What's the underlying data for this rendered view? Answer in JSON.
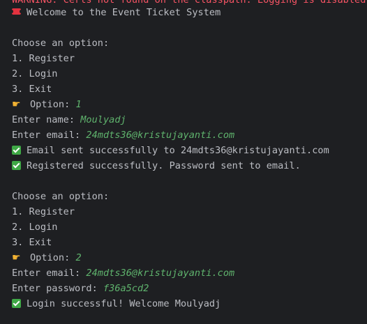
{
  "console": {
    "warning": "WARNING: Certs not found on the classpath. Logging is disabled.",
    "welcome": "Welcome to the Event Ticket System",
    "menu1": {
      "header": "Choose an option:",
      "opt1": "1. Register",
      "opt2": "2. Login",
      "opt3": "3. Exit",
      "option_prompt": "Option: ",
      "option_value": "1"
    },
    "register": {
      "name_prompt": "Enter name: ",
      "name_value": "Moulyadj",
      "email_prompt": "Enter email: ",
      "email_value": "24mdts36@kristujayanti.com",
      "msg_email_sent": "Email sent successfully to 24mdts36@kristujayanti.com",
      "msg_registered": "Registered successfully. Password sent to email."
    },
    "menu2": {
      "header": "Choose an option:",
      "opt1": "1. Register",
      "opt2": "2. Login",
      "opt3": "3. Exit",
      "option_prompt": "Option: ",
      "option_value": "2"
    },
    "login": {
      "email_prompt": "Enter email: ",
      "email_value": "24mdts36@kristujayanti.com",
      "password_prompt": "Enter password: ",
      "password_value": "f36a5cd2",
      "msg_success": "Login successful! Welcome Moulyadj"
    },
    "icons": {
      "ticket": "ticket-icon",
      "pointer": "pointing-hand-icon",
      "check": "check-mark-icon"
    },
    "colors": {
      "background": "#1e1f22",
      "text": "#bcbec4",
      "input": "#5fb36d",
      "warning": "#f75464",
      "check": "#3fa846"
    }
  }
}
